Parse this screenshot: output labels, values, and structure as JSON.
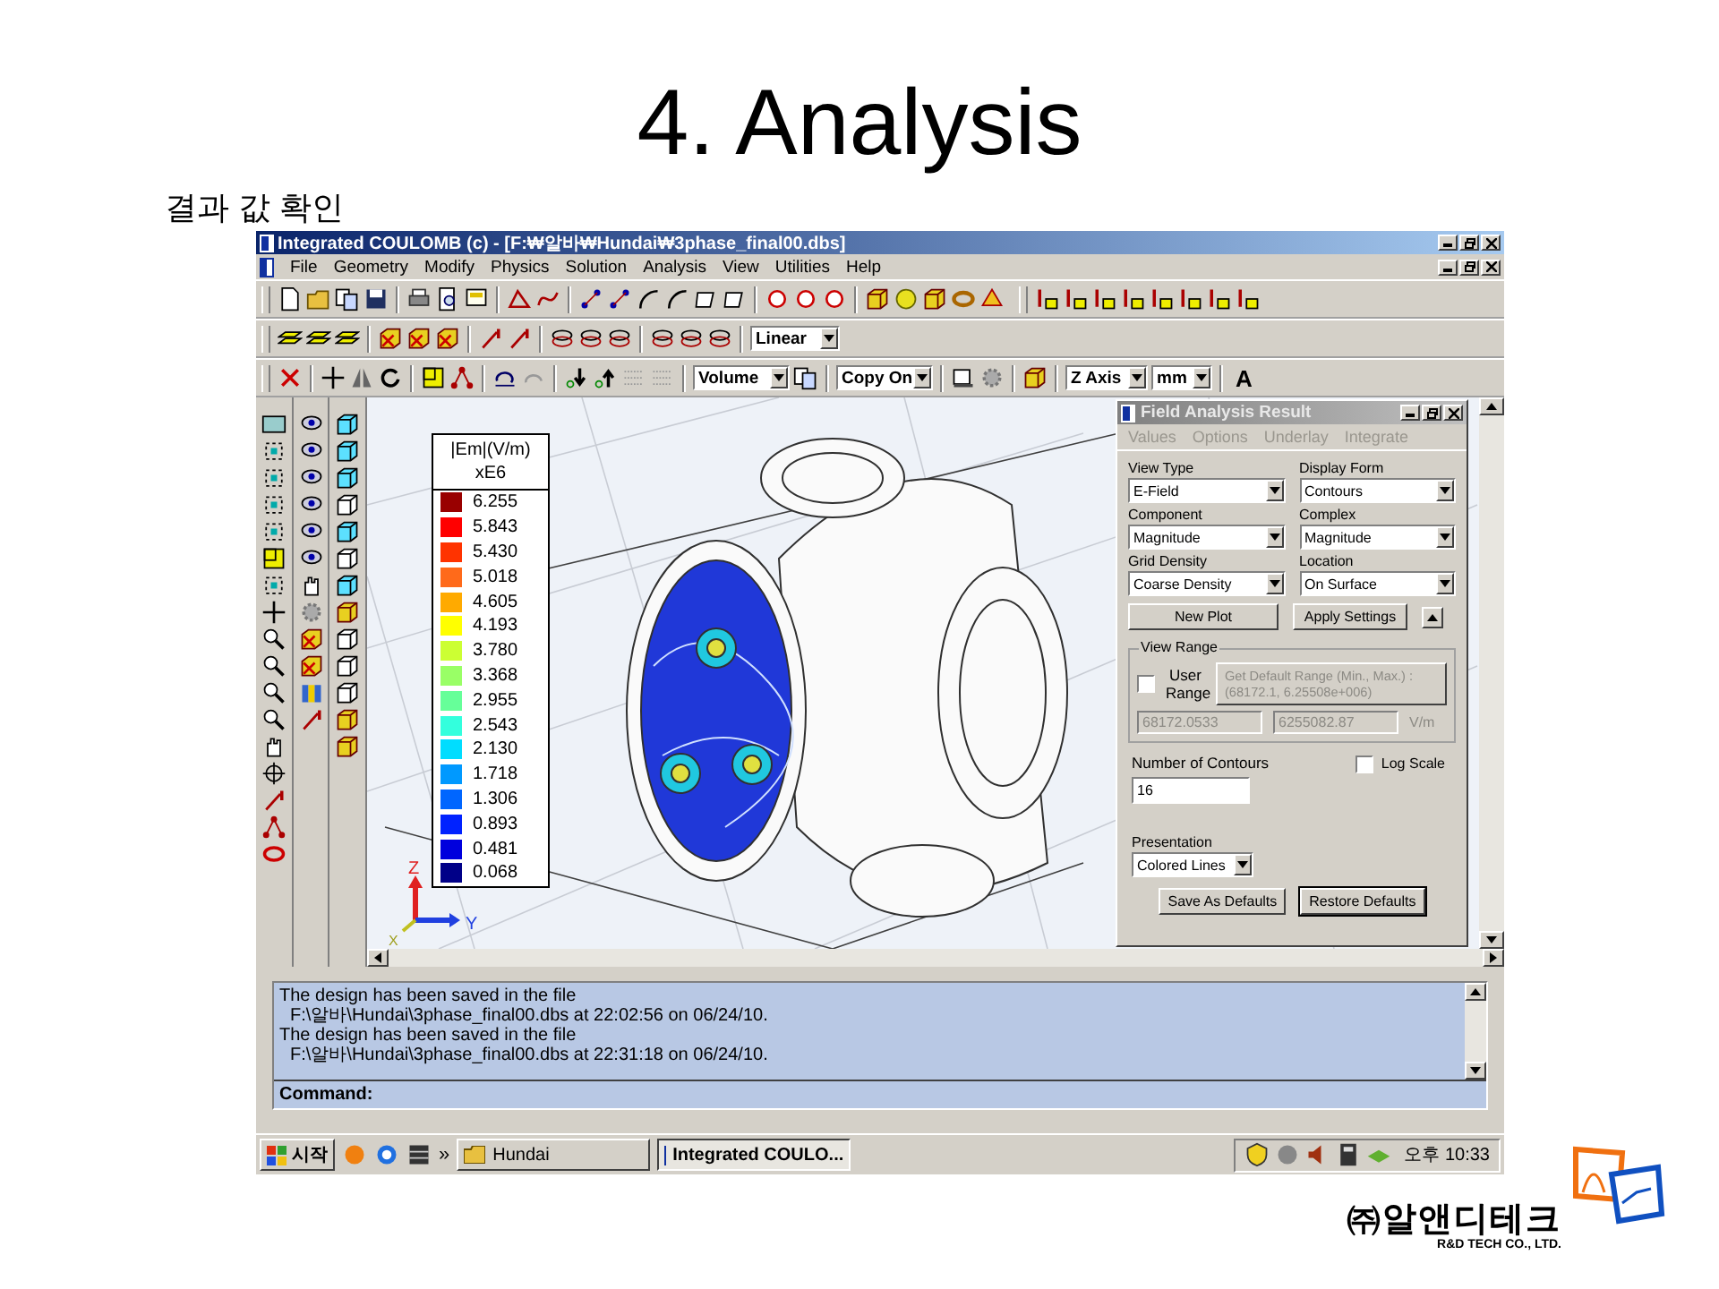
{
  "slide": {
    "title": "4. Analysis",
    "subtitle": "결과 값 확인"
  },
  "app": {
    "title": "Integrated COULOMB (c) - [F:₩알바₩Hundai₩3phase_final00.dbs]",
    "menu": [
      "File",
      "Geometry",
      "Modify",
      "Physics",
      "Solution",
      "Analysis",
      "View",
      "Utilities",
      "Help"
    ],
    "toolbar_2": {
      "dropdown": "Linear"
    },
    "toolbar_3": {
      "dropdowns": [
        "Volume",
        "Copy On",
        "Z Axis",
        "mm"
      ],
      "text_button": "A"
    },
    "legend": {
      "title": "|Em|(V/m)",
      "scale": "xE6",
      "entries": [
        {
          "value": "6.255",
          "color": "#990000"
        },
        {
          "value": "5.843",
          "color": "#ff0000"
        },
        {
          "value": "5.430",
          "color": "#ff3300"
        },
        {
          "value": "5.018",
          "color": "#ff6a1a"
        },
        {
          "value": "4.605",
          "color": "#ffaa00"
        },
        {
          "value": "4.193",
          "color": "#ffff00"
        },
        {
          "value": "3.780",
          "color": "#ccff33"
        },
        {
          "value": "3.368",
          "color": "#99ff66"
        },
        {
          "value": "2.955",
          "color": "#66ff99"
        },
        {
          "value": "2.543",
          "color": "#33ffdd"
        },
        {
          "value": "2.130",
          "color": "#00ddff"
        },
        {
          "value": "1.718",
          "color": "#0099ff"
        },
        {
          "value": "1.306",
          "color": "#0066ff"
        },
        {
          "value": "0.893",
          "color": "#0022ff"
        },
        {
          "value": "0.481",
          "color": "#0000dd"
        },
        {
          "value": "0.068",
          "color": "#000088"
        }
      ]
    },
    "axis_labels": [
      "Z",
      "Y",
      "X"
    ],
    "dialog": {
      "title": "Field Analysis Result",
      "menu": [
        {
          "label": "Values",
          "disabled": true
        },
        {
          "label": "Options",
          "disabled": true
        },
        {
          "label": "Underlay",
          "disabled": true
        },
        {
          "label": "Integrate",
          "disabled": true
        }
      ],
      "fields": [
        {
          "label": "View Type",
          "value": "E-Field"
        },
        {
          "label": "Display Form",
          "value": "Contours"
        },
        {
          "label": "Component",
          "value": "Magnitude"
        },
        {
          "label": "Complex",
          "value": "Magnitude"
        },
        {
          "label": "Grid Density",
          "value": "Coarse Density"
        },
        {
          "label": "Location",
          "value": "On Surface"
        }
      ],
      "buttons": [
        "New Plot",
        "Apply Settings"
      ],
      "view_range": {
        "label": "View Range",
        "user_range": {
          "label": "User Range",
          "checked": false
        },
        "default_button": {
          "lines": [
            "Get Default Range (Min., Max.) :",
            "(68172.1, 6.25508e+006)"
          ],
          "disabled": true
        },
        "min": {
          "value": "68172.0533",
          "disabled": true
        },
        "max": {
          "value": "6255082.87",
          "disabled": true
        },
        "unit": "V/m"
      },
      "contours": {
        "label": "Number of Contours",
        "value": "16"
      },
      "log_scale": {
        "label": "Log Scale",
        "checked": false
      },
      "presentation": {
        "label": "Presentation",
        "value": "Colored Lines"
      },
      "footer_buttons": [
        "Save As Defaults",
        "Restore Defaults"
      ]
    },
    "log": [
      {
        "message": "The design has been saved in the file",
        "path": "F:\\알바\\Hundai\\3phase_final00.dbs at 22:02:56 on 06/24/10."
      },
      {
        "message": "The design has been saved in the file",
        "path": "F:\\알바\\Hundai\\3phase_final00.dbs at 22:31:18 on 06/24/10."
      }
    ],
    "command_label": "Command:"
  },
  "taskbar": {
    "start": "시작",
    "chevron": "»",
    "tasks": [
      {
        "label": "Hundai",
        "selected": false
      },
      {
        "label": "Integrated COULO...",
        "selected": true
      }
    ],
    "clock": "오후 10:33"
  },
  "logo": {
    "name": "㈜알앤디테크",
    "tagline": "R&D TECH CO., LTD."
  }
}
